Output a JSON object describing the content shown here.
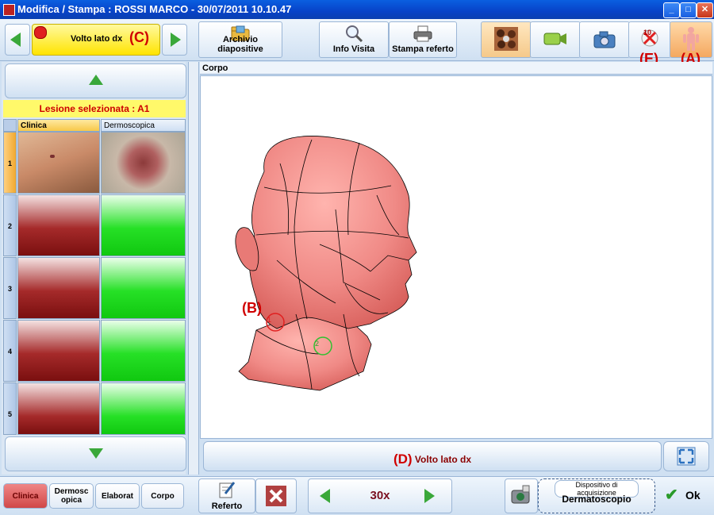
{
  "window": {
    "title": "Modifica / Stampa : ROSSI MARCO - 30/07/2011 10.10.47",
    "controls": [
      "minimize",
      "maximize",
      "close"
    ]
  },
  "toolbar": {
    "selector": {
      "label": "Volto lato dx",
      "annotation": "(C)"
    },
    "buttons": [
      {
        "label": "Archivio diapositive",
        "icon": "folder-icon"
      },
      {
        "label": "Info Visita",
        "icon": "magnifier-icon"
      },
      {
        "label": "Stampa referto",
        "icon": "printer-icon"
      }
    ],
    "mode_icons": [
      "dermatoscope-view-icon",
      "video-camera-icon",
      "photo-camera-icon",
      "no-lesion-icon",
      "body-map-icon"
    ],
    "no_lesion_badge": "10",
    "annotation_e": "(E)",
    "annotation_a": "(A)"
  },
  "left_panel": {
    "lesion_selected": "Lesione selezionata : A1",
    "columns": [
      "Clinica",
      "Dermoscopica"
    ],
    "rows": [
      "1",
      "2",
      "3",
      "4",
      "5"
    ]
  },
  "main": {
    "section_title": "Corpo",
    "annotation_b": "(B)",
    "markers": [
      "1",
      "2"
    ],
    "view_label": "Volto lato dx",
    "annotation_d": "(D)"
  },
  "bottom": {
    "tabs": [
      {
        "label": "Clinica",
        "active": true
      },
      {
        "label": "Dermosc opica",
        "active": false
      },
      {
        "label": "Elaborat",
        "active": false
      },
      {
        "label": "Corpo",
        "active": false
      }
    ],
    "referto_label": "Referto",
    "zoom": "30x",
    "device_caption": "Dispositivo di acquisizione",
    "device_name": "Dermatoscopio",
    "ok_label": "Ok"
  },
  "colors": {
    "accent_yellow": "#ffe400",
    "annotation_red": "#d00000",
    "active_tab": "#d04848",
    "marker_red": "#e02020",
    "marker_green": "#30c030"
  }
}
